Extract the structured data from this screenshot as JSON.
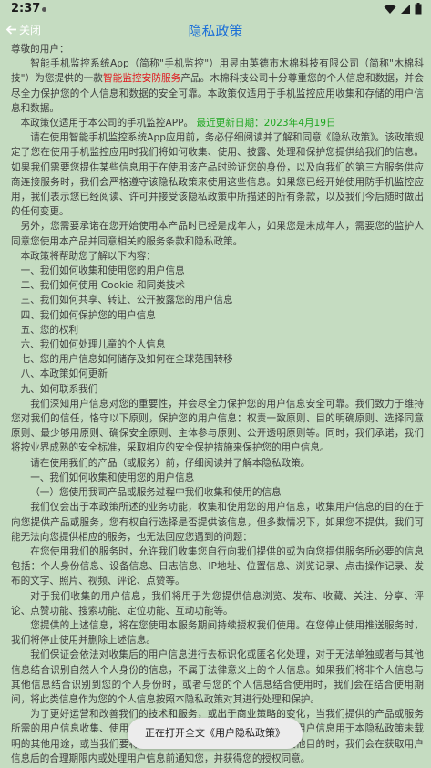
{
  "status_bar": {
    "time": "2:37"
  },
  "appbar": {
    "back_label": "关闭",
    "title": "隐私政策"
  },
  "body": {
    "p1": "尊敬的用户：",
    "p2a": "智能手机监控系统App（简称\"手机监控\"）用昱由英德市木棉科技有限公司（简称\"木棉科技\"）为您提供的一款",
    "p2_highlight": "智能监控安防服务",
    "p2b": "产品。木棉科技公司十分尊重您的个人信息和数据，并会尽全力保护您的个人信息和数据的安全可靠。本政策仅适用于手机监控应用收集和存储的用户信息和数据。",
    "p3a": "本政策仅适用于本公司的手机监控APP。",
    "p3_update": "最近更新日期：2023年4月19日",
    "p4": "请在使用智能手机监控系统App应用前，务必仔细阅读并了解和同意《隐私政策》。该政策规定了您在使用手机监控应用时我们将如何收集、使用、披露、处理和保护您提供给我们的信息。如果我们需要您提供某些信息用于在使用该产品时验证您的身份，以及向我们的第三方服务供应商连接服务时，我们会严格遵守该隐私政策来使用这些信息。如果您已经开始使用防手机监控应用，我们表示您已经阅读、许可并接受该隐私政策中所描述的所有条款，以及我们今后随时做出的任何变更。",
    "p5": "另外，您需要承诺在您开始使用本产品时已经是成年人，如果您是未成年人，需要您的监护人同意您使用本产品并同意相关的服务条款和隐私政策。",
    "p6": "本政策将帮助您了解以下内容：",
    "toc": [
      "一、我们如何收集和使用您的用户信息",
      "二、我们如何使用 Cookie 和同类技术",
      "三、我们如何共享、转让、公开披露您的用户信息",
      "四、我们如何保护您的用户信息",
      "五、您的权利",
      "六、我们如何处理儿童的个人信息",
      "七、您的用户信息如何储存及如何在全球范围转移",
      "八、本政策如何更新",
      "九、如何联系我们"
    ],
    "p7": "我们深知用户信息对您的重要性，并会尽全力保护您的用户信息安全可靠。我们致力于维持您对我们的信任，恪守以下原则，保护您的用户信息：权责一致原则、目的明确原则、选择同意原则、最少够用原则、确保安全原则、主体参与原则、公开透明原则等。同时，我们承诺，我们将按业界成熟的安全标准，采取相应的安全保护措施来保护您的用户信息。",
    "p8": "请在使用我们的产品（或服务）前，仔细阅读并了解本隐私政策。",
    "h1": "一、我们如何收集和使用您的用户信息",
    "h2": "（一）您使用我司产品或服务过程中我们收集和使用的信息",
    "p9": "我们仅会出于本政策所述的业务功能，收集和使用您的用户信息，收集用户信息的目的在于向您提供产品或服务，您有权自行选择是否提供该信息，但多数情况下，如果您不提供，我们可能无法向您提供相应的服务，也无法回应您遇到的问题：",
    "p10": "在您使用我们的服务时，允许我们收集您自行向我们提供的或为向您提供服务所必要的信息包括：个人身份信息、设备信息、日志信息、IP地址、位置信息、浏览记录、点击操作记录、发布的文字、照片、视频、评论、点赞等。",
    "p11": "对于我们收集的用户信息，我们将用于为您提供信息浏览、发布、收藏、关注、分享、评论、点赞功能、搜索功能、定位功能、互动功能等。",
    "p12": "您提供的上述信息，将在您使用本服务期间持续授权我们使用。在您停止使用推送服务时，我们将停止使用并删除上述信息。",
    "p13": "我们保证会依法对收集后的用户信息进行去标识化或匿名化处理，对于无法单独或者与其他信息结合识别自然人个人身份的信息，不属于法律意义上的个人信息。如果我们将非个人信息与其他信息结合识别到您的个人身份时，或者与您的个人信息结合使用时，我们会在结合使用期间，将此类信息作为您的个人信息按照本隐私政策对其进行处理和保护。",
    "p14": "为了更好运营和改善我们的技术和服务，或出于商业策略的变化，当我们提供的产品或服务所需的用户信息收集、使用、处理超出上述范围或者要将收集到的用户信息用于本隐私政策未载明的其他用途，或当我们要将基于特定目的收集而来的信息用于其他目的时，我们会在获取用户信息后的合理期限内或处理用户信息前通知您，并获得您的授权同意。"
  },
  "toast": {
    "text": "正在打开全文《用户隐私政策》"
  }
}
